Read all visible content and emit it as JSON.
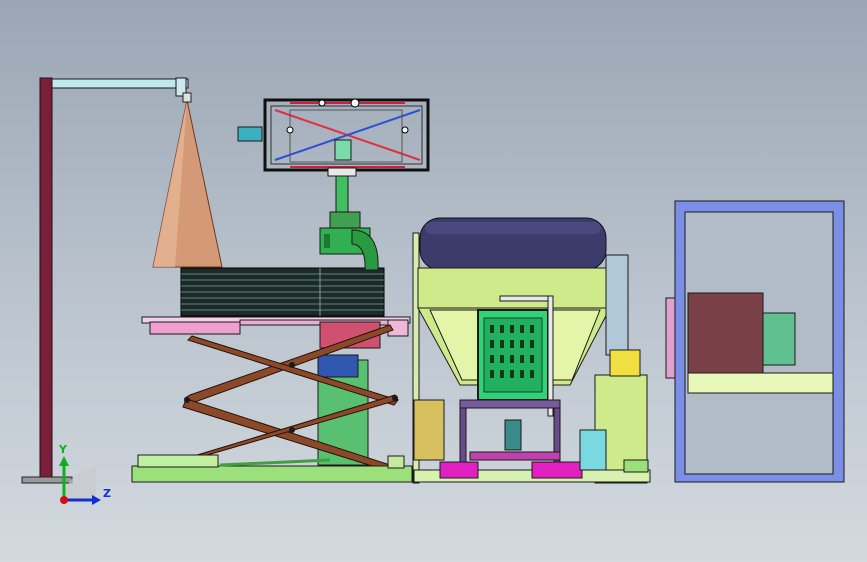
{
  "view": {
    "background_top": "#9aa6b4",
    "background_bottom": "#d3d9df"
  },
  "triad": {
    "y_label": "Y",
    "z_label": "Z",
    "x_axis_color": "#d01010",
    "y_axis_color": "#10b020",
    "z_axis_color": "#1030d0"
  },
  "parts": [
    "gantry-post",
    "cone-hopper",
    "rotary-gripper-frame",
    "gripper-drive-motor",
    "stacked-plates",
    "scissor-lift",
    "lift-base-plate",
    "drum-roller",
    "feed-hopper",
    "control-cabinet",
    "side-enclosure-frame"
  ],
  "colors": {
    "post": "#7a1f3a",
    "cone": "#d49a78",
    "scissor": "#8a4a2a",
    "base_green": "#9be07a",
    "hopper_green": "#cfea8a",
    "cabinet_green": "#33d07a",
    "drum": "#3c3c6a",
    "enclosure": "#7b8fe6",
    "brown_box": "#7a4048",
    "pink_table": "#f0a0d0",
    "magenta": "#e020c0"
  }
}
